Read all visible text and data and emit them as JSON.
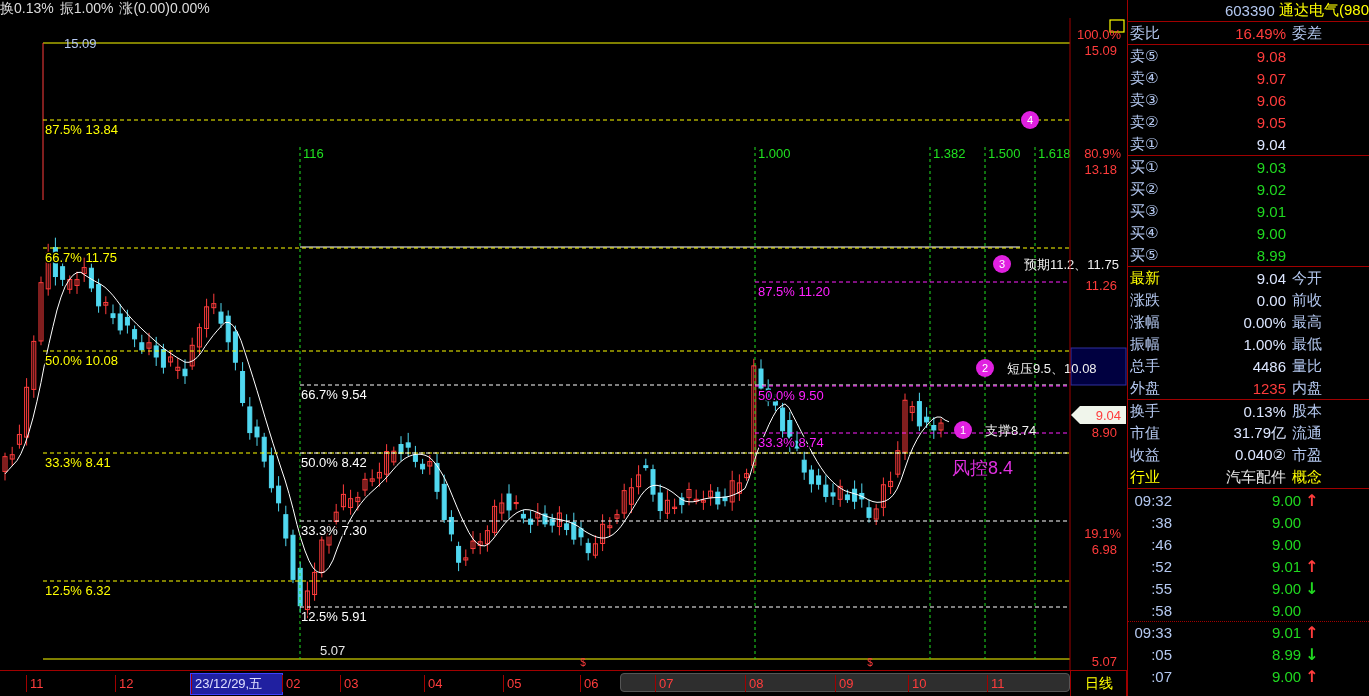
{
  "quote_bar": {
    "items": [
      "换0.13%",
      "振1.00%",
      "涨(0.00)0.00%"
    ]
  },
  "chart": {
    "top_price": "15.09",
    "bottom_price": "5.07",
    "fib_sets": [
      {
        "kind": "yellow",
        "levels": [
          {
            "label": "87.5% 13.84"
          },
          {
            "label": "66.7% 11.75"
          },
          {
            "label": "50.0% 10.08"
          },
          {
            "label": "33.3% 8.41"
          },
          {
            "label": "12.5% 6.32"
          }
        ]
      },
      {
        "kind": "white",
        "levels": [
          {
            "label": "66.7% 9.54"
          },
          {
            "label": "50.0% 8.42"
          },
          {
            "label": "33.3% 7.30"
          },
          {
            "label": "12.5% 5.91"
          }
        ]
      },
      {
        "kind": "magenta",
        "levels": [
          {
            "label": "87.5% 11.20"
          },
          {
            "label": "50.0% 9.50"
          },
          {
            "label": "33.3% 8.74"
          }
        ]
      }
    ],
    "time_ratios": [
      {
        "label": "116"
      },
      {
        "label": "1.000"
      },
      {
        "label": "1.382"
      },
      {
        "label": "1.500"
      },
      {
        "label": "1.618"
      }
    ],
    "markers": [
      {
        "number": "4"
      },
      {
        "number": "3",
        "note": "预期11.2、11.75"
      },
      {
        "number": "2",
        "note": "短压9.5、10.08"
      },
      {
        "number": "1",
        "note": "支撑8.74"
      }
    ],
    "risk_note": "风控8.4",
    "bottom_flags": [
      "$",
      "$"
    ]
  },
  "price_axis": {
    "labels": [
      {
        "pct": "100.0%",
        "price": "15.09"
      },
      {
        "pct": "80.9%",
        "price": "13.18"
      },
      {
        "price": "11.26"
      },
      {
        "price": "8.90"
      },
      {
        "pct": "19.1%",
        "price": "6.98"
      },
      {
        "price": "5.07"
      }
    ],
    "current": "9.04"
  },
  "date_axis": {
    "labels": [
      {
        "text": "11",
        "selected": false
      },
      {
        "text": "12",
        "selected": false
      },
      {
        "text": "23/12/29,五",
        "selected": true
      },
      {
        "text": "02",
        "selected": false
      },
      {
        "text": "03",
        "selected": false
      },
      {
        "text": "04",
        "selected": false
      },
      {
        "text": "05",
        "selected": false
      },
      {
        "text": "06",
        "selected": false
      },
      {
        "text": "07",
        "selected": false
      },
      {
        "text": "08",
        "selected": false
      },
      {
        "text": "09",
        "selected": false
      },
      {
        "text": "10",
        "selected": false
      },
      {
        "text": "11",
        "selected": false
      }
    ],
    "period": "日线"
  },
  "quote_panel": {
    "code": "603390",
    "name": "通达电气(980",
    "ratio": {
      "label": "委比",
      "value": "16.49%",
      "label2": "委差"
    },
    "asks": [
      {
        "label": "卖⑤",
        "price": "9.08",
        "color": "#ff3c3c"
      },
      {
        "label": "卖④",
        "price": "9.07",
        "color": "#ff3c3c"
      },
      {
        "label": "卖③",
        "price": "9.06",
        "color": "#ff3c3c"
      },
      {
        "label": "卖②",
        "price": "9.05",
        "color": "#ff3c3c"
      },
      {
        "label": "卖①",
        "price": "9.04",
        "color": "#dce6ff"
      }
    ],
    "bids": [
      {
        "label": "买①",
        "price": "9.03",
        "color": "#20d820"
      },
      {
        "label": "买②",
        "price": "9.02",
        "color": "#20d820"
      },
      {
        "label": "买③",
        "price": "9.01",
        "color": "#20d820"
      },
      {
        "label": "买④",
        "price": "9.00",
        "color": "#20d820"
      },
      {
        "label": "买⑤",
        "price": "8.99",
        "color": "#20d820"
      }
    ],
    "stats": [
      {
        "label": "最新",
        "value": "9.04",
        "label2": "今开",
        "color": "#dce6ff",
        "label_accent": true,
        "label2_accent": false
      },
      {
        "label": "涨跌",
        "value": "0.00",
        "label2": "前收",
        "color": "#dce6ff",
        "label_accent": false,
        "label2_accent": false
      },
      {
        "label": "涨幅",
        "value": "0.00%",
        "label2": "最高",
        "color": "#dce6ff",
        "label_accent": false,
        "label2_accent": false
      },
      {
        "label": "振幅",
        "value": "1.00%",
        "label2": "最低",
        "color": "#dce6ff",
        "label_accent": false,
        "label2_accent": false
      },
      {
        "label": "总手",
        "value": "4486",
        "label2": "量比",
        "color": "#dce6ff",
        "label_accent": false,
        "label2_accent": false
      },
      {
        "label": "外盘",
        "value": "1235",
        "label2": "内盘",
        "color": "#ff3c3c",
        "label_accent": false,
        "label2_accent": false
      }
    ],
    "info": [
      {
        "label": "换手",
        "value": "0.13%",
        "label2": "股本",
        "color": "#dce6ff",
        "label_accent": false,
        "label2_accent": false
      },
      {
        "label": "市值",
        "value": "31.79亿",
        "label2": "流通",
        "color": "#dce6ff",
        "label_accent": false,
        "label2_accent": false
      },
      {
        "label": "收益",
        "value": "0.040②",
        "label2": "市盈",
        "color": "#dce6ff",
        "label_accent": false,
        "label2_accent": false
      },
      {
        "label": "行业",
        "value": "汽车配件",
        "label2": "概念",
        "color": "#e6e6e6",
        "label_accent": true,
        "label2_accent": true
      }
    ],
    "trades": [
      {
        "time": "09:32",
        "price": "9.00",
        "arrow": "↑",
        "color": "#ff3c3c",
        "separator_before": false
      },
      {
        "time": ":38",
        "price": "9.00",
        "separator_before": false
      },
      {
        "time": ":46",
        "price": "9.00",
        "separator_before": false
      },
      {
        "time": ":52",
        "price": "9.01",
        "arrow": "↑",
        "color": "#ff3c3c",
        "separator_before": false
      },
      {
        "time": ":55",
        "price": "9.00",
        "arrow": "↓",
        "color": "#20d820",
        "separator_before": false
      },
      {
        "time": ":58",
        "price": "9.00",
        "separator_before": false
      },
      {
        "time": "09:33",
        "price": "9.01",
        "arrow": "↑",
        "color": "#ff3c3c",
        "separator_before": true
      },
      {
        "time": ":05",
        "price": "8.99",
        "arrow": "↓",
        "color": "#20d820",
        "separator_before": false
      },
      {
        "time": ":07",
        "price": "9.00",
        "arrow": "↑",
        "color": "#ff3c3c",
        "separator_before": false
      }
    ]
  }
}
